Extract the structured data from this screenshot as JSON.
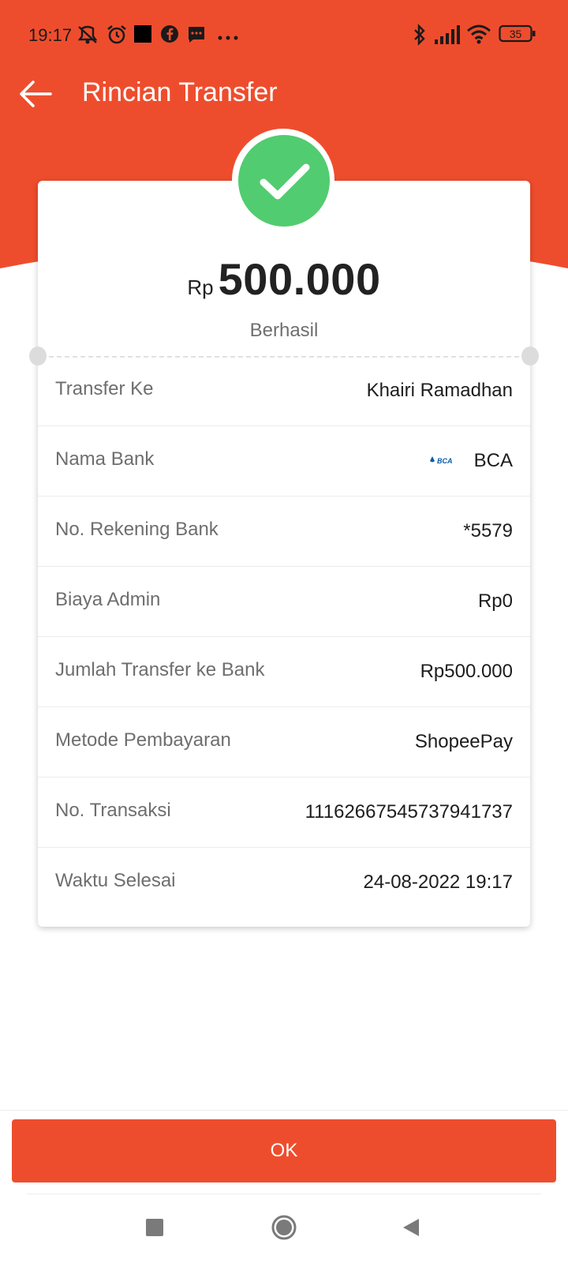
{
  "colors": {
    "brand": "#ee4d2d",
    "success": "#52cc70"
  },
  "status_bar": {
    "time": "19:17",
    "battery": "35",
    "icons": [
      "muted-vibrate-icon",
      "alarm-icon",
      "square-notification-icon",
      "facebook-icon",
      "message-icon",
      "more-dots-icon",
      "bluetooth-icon",
      "signal-icon",
      "wifi-icon",
      "battery-icon"
    ]
  },
  "appbar": {
    "title": "Rincian Transfer"
  },
  "summary": {
    "currency": "Rp",
    "amount": "500.000",
    "status": "Berhasil"
  },
  "details": [
    {
      "label": "Transfer Ke",
      "value": "Khairi Ramadhan"
    },
    {
      "label": "Nama Bank",
      "value": "BCA",
      "logo": "BCA"
    },
    {
      "label": "No. Rekening Bank",
      "value": "*5579"
    },
    {
      "label": "Biaya Admin",
      "value": "Rp0"
    },
    {
      "label": "Jumlah Transfer ke Bank",
      "value": "Rp500.000"
    },
    {
      "label": "Metode Pembayaran",
      "value": "ShopeePay"
    },
    {
      "label": "No. Transaksi",
      "value": "11162667545737941737"
    },
    {
      "label": "Waktu Selesai",
      "value": "24-08-2022 19:17"
    }
  ],
  "actions": {
    "ok_label": "OK"
  },
  "nav": {
    "items": [
      "recent-apps-icon",
      "home-icon",
      "back-triangle-icon"
    ]
  }
}
